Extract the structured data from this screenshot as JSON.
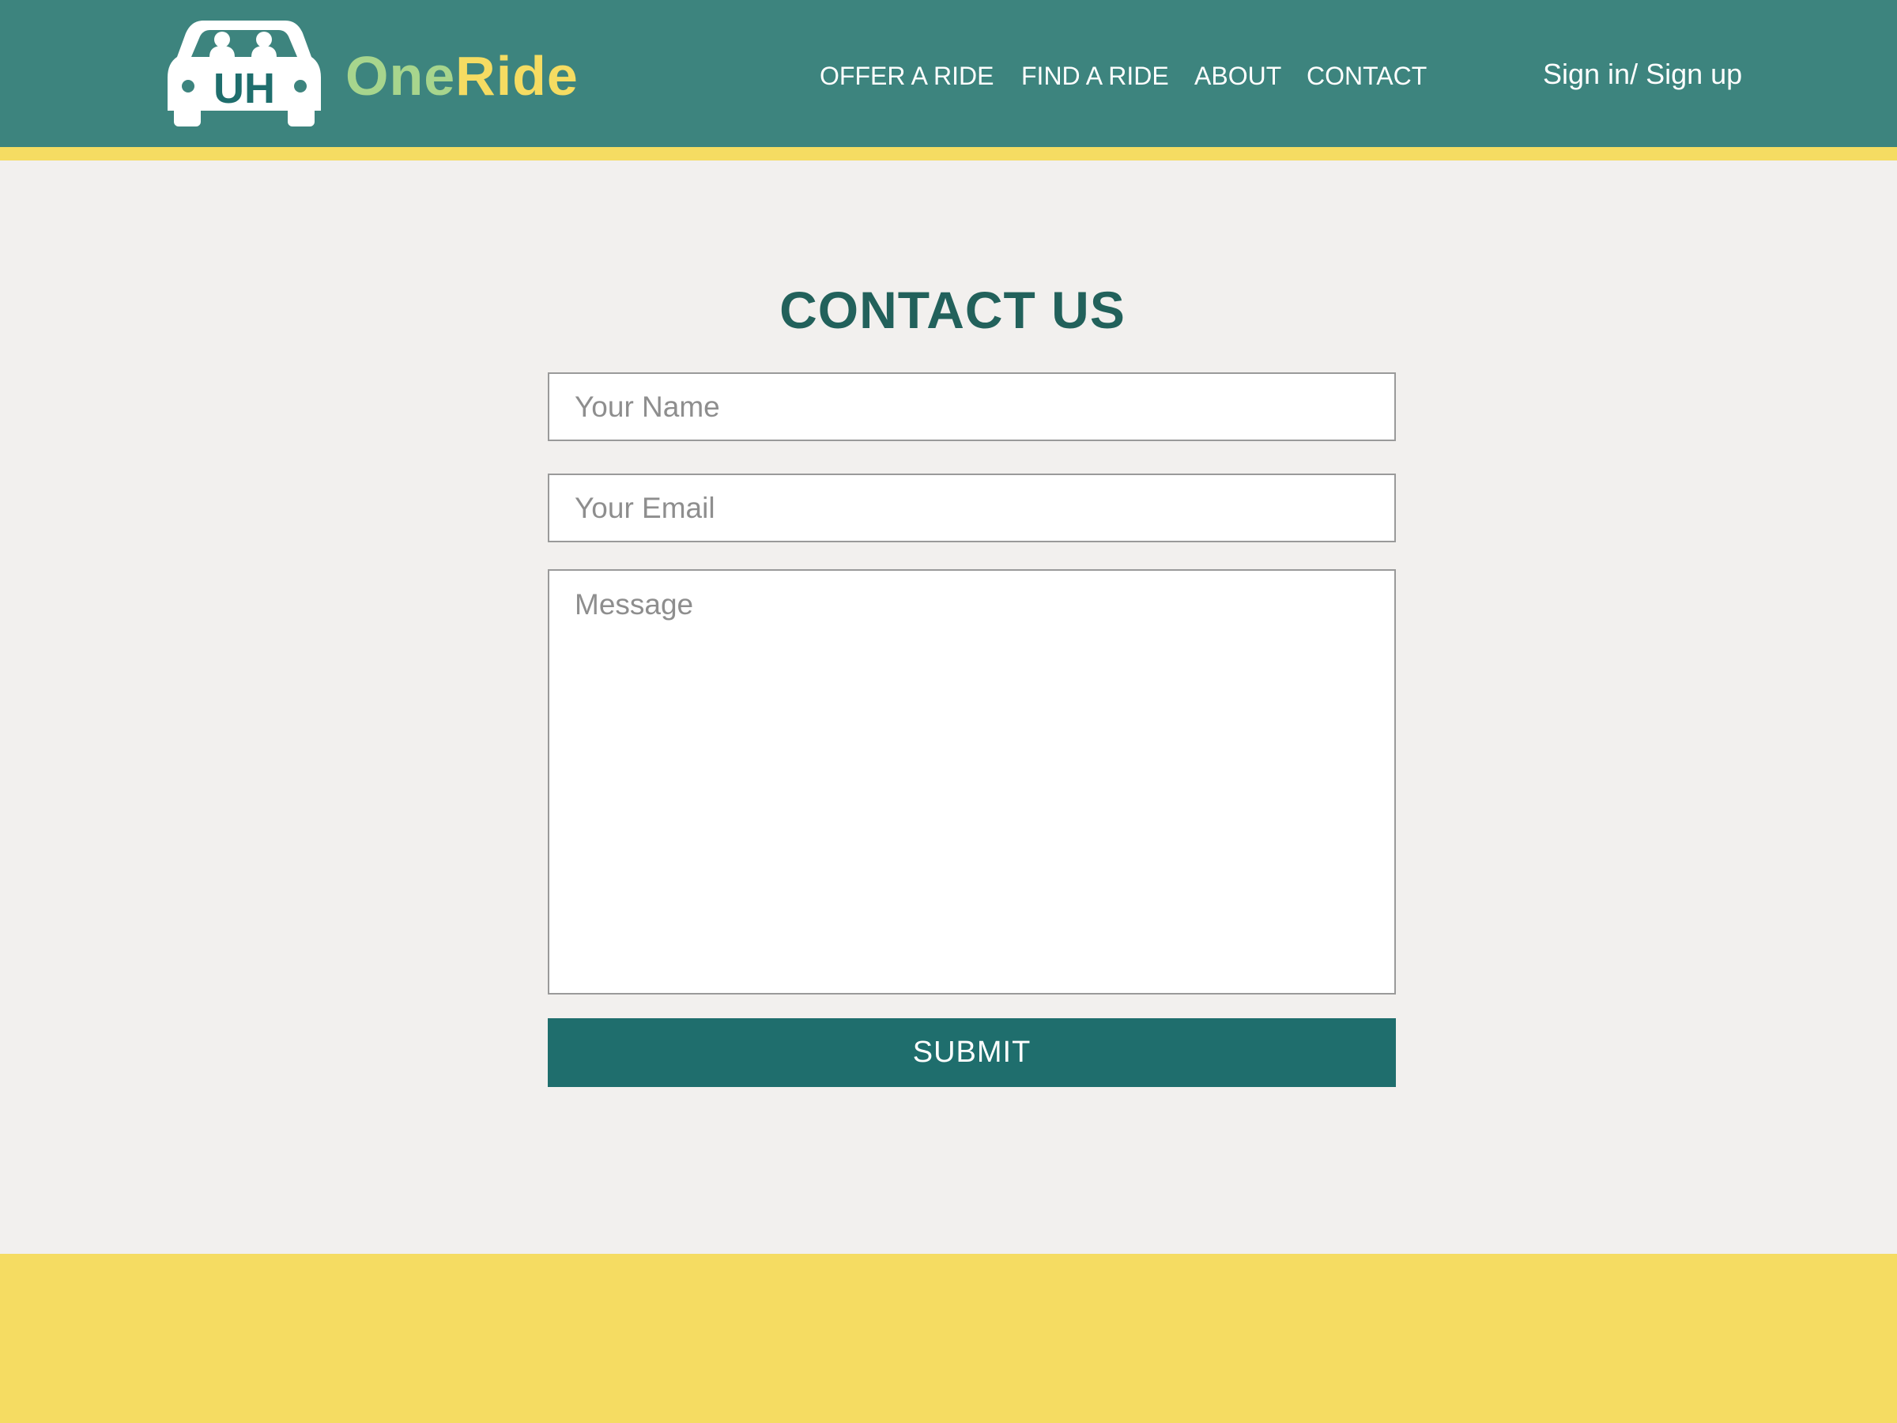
{
  "brand": {
    "logo_text": "UH",
    "name_part1": "One",
    "name_part2": "Ride",
    "colors": {
      "header_bg": "#3d847e",
      "accent_yellow": "#f5dc62",
      "accent_green": "#a7d58d"
    }
  },
  "nav": {
    "items": [
      {
        "label": "OFFER A RIDE"
      },
      {
        "label": "FIND A RIDE"
      },
      {
        "label": "ABOUT"
      },
      {
        "label": "CONTACT"
      }
    ],
    "signin_label": "Sign in/ Sign up"
  },
  "main": {
    "title": "CONTACT US",
    "form": {
      "name_placeholder": "Your Name",
      "name_value": "",
      "email_placeholder": "Your Email",
      "email_value": "",
      "message_placeholder": "Message",
      "message_value": "",
      "submit_label": "SUBMIT",
      "submit_color": "#1f6e6d"
    }
  },
  "icons": {
    "logo": "car-logo-icon"
  }
}
